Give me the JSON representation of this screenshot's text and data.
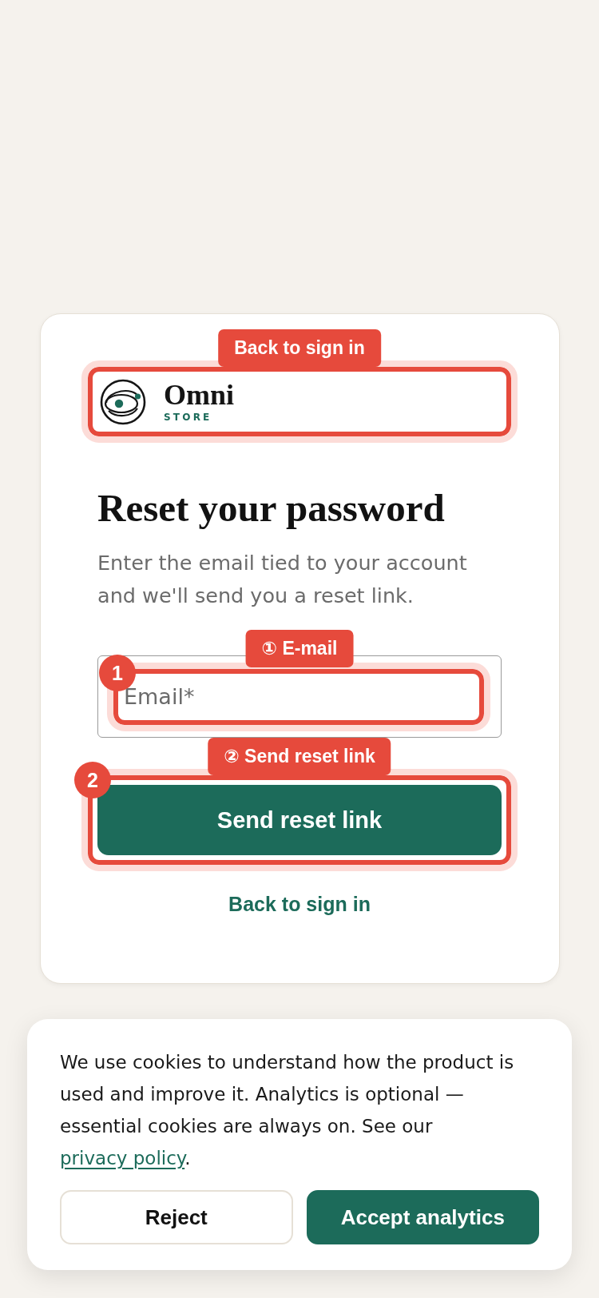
{
  "logo": {
    "name": "Omni",
    "tagline": "STORE",
    "annotation": {
      "label": "Back to sign in"
    }
  },
  "heading": "Reset your password",
  "subtitle": "Enter the email tied to your account and we'll send you a reset link.",
  "email_field": {
    "placeholder": "Email*",
    "annotation": {
      "label": "① E-mail",
      "badge": "1"
    }
  },
  "submit_button": {
    "label": "Send reset link",
    "annotation": {
      "label": "② Send reset link",
      "badge": "2"
    }
  },
  "back_link": "Back to sign in",
  "cookie_banner": {
    "text": "We use cookies to understand how the product is used and improve it. Analytics is optional — essential cookies are always on. See our",
    "link": "privacy policy",
    "text_end": ".",
    "buttons": [
      {
        "label": "Reject",
        "kind": "secondary"
      },
      {
        "label": "Accept analytics",
        "kind": "primary"
      }
    ]
  }
}
